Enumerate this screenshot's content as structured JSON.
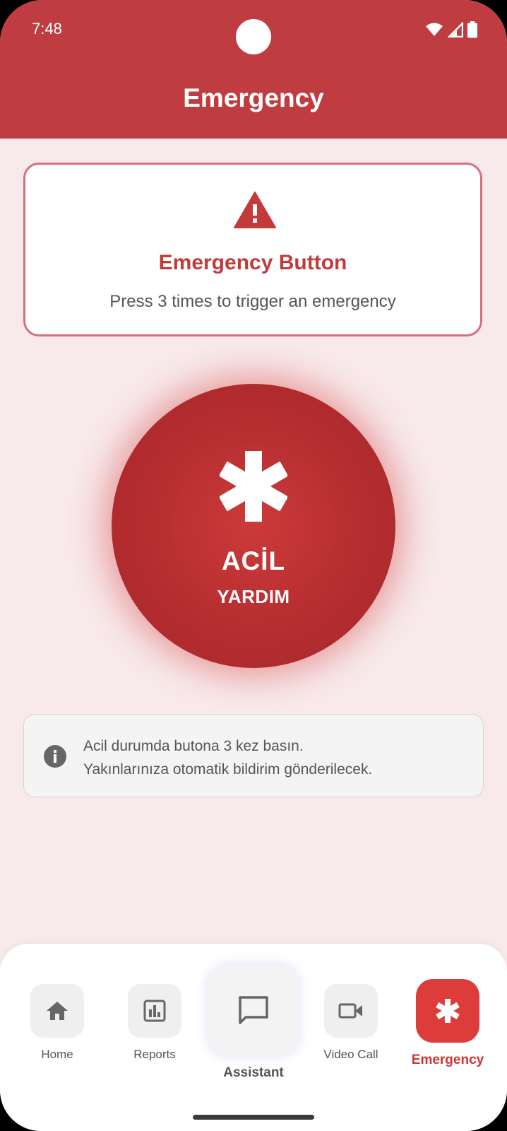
{
  "status_bar": {
    "time": "7:48",
    "icons": [
      "wifi-icon",
      "signal-icon",
      "battery-icon"
    ]
  },
  "header": {
    "title": "Emergency"
  },
  "info_card": {
    "icon": "warning-icon",
    "title": "Emergency Button",
    "subtitle": "Press 3 times to trigger an emergency"
  },
  "sos_button": {
    "icon": "asterisk-icon",
    "line1": "ACİL",
    "line2": "YARDIM"
  },
  "note": {
    "icon": "info-icon",
    "line1": "Acil durumda butona 3 kez basın.",
    "line2": "Yakınlarınıza otomatik bildirim gönderilecek."
  },
  "nav": {
    "items": [
      {
        "label": "Home",
        "icon": "home-icon"
      },
      {
        "label": "Reports",
        "icon": "reports-icon"
      },
      {
        "label": "Assistant",
        "icon": "chat-icon"
      },
      {
        "label": "Video Call",
        "icon": "video-camera-icon"
      },
      {
        "label": "Emergency",
        "icon": "asterisk-icon",
        "active": true
      }
    ]
  },
  "colors": {
    "primary": "#bf3d40",
    "accent": "#dc3d3a",
    "background": "#f8e9ea"
  }
}
